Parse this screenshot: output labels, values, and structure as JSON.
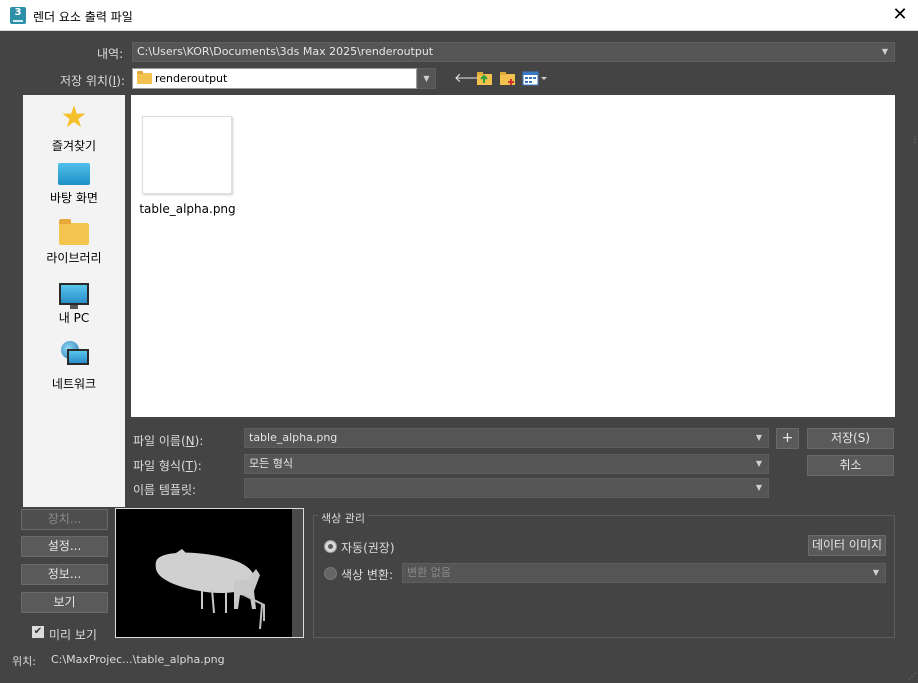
{
  "window": {
    "title": "렌더 요소 출력 파일",
    "app_badge": "3"
  },
  "history": {
    "label": "내역:",
    "value": "C:\\Users\\KOR\\Documents\\3ds Max 2025\\renderoutput"
  },
  "save_in": {
    "label_pre": "저장 위치(",
    "label_key": "I",
    "label_post": "):",
    "value": "renderoutput"
  },
  "toolbar": {
    "icons": [
      "back-arrow-icon",
      "up-folder-icon",
      "new-folder-icon",
      "view-menu-icon"
    ]
  },
  "places": [
    {
      "label": "즐겨찾기",
      "icon": "star-icon"
    },
    {
      "label": "바탕 화면",
      "icon": "desktop-icon"
    },
    {
      "label": "라이브러리",
      "icon": "library-folder-icon"
    },
    {
      "label": "내 PC",
      "icon": "pc-icon"
    },
    {
      "label": "네트워크",
      "icon": "network-icon"
    }
  ],
  "files": [
    {
      "name": "table_alpha.png"
    }
  ],
  "filename": {
    "label_pre": "파일 이름(",
    "label_key": "N",
    "label_post": "):",
    "value": "table_alpha.png"
  },
  "filetype": {
    "label_pre": "파일 형식(",
    "label_key": "T",
    "label_post": "):",
    "value": "모든 형식"
  },
  "name_template": {
    "label": "이름 템플릿:",
    "value": ""
  },
  "buttons": {
    "plus": "+",
    "save": "저장(S)",
    "cancel": "취소",
    "device": "장치...",
    "setup": "설정...",
    "info": "정보...",
    "view": "보기",
    "data_image": "데이터 이미지"
  },
  "preview_checkbox": {
    "label": "미리 보기",
    "checked": true
  },
  "color_management": {
    "title": "색상 관리",
    "auto_label": "자동(권장)",
    "transform_label": "색상 변환:",
    "transform_value": "변환 없음"
  },
  "status": {
    "label": "위치:",
    "value": "C:\\MaxProjec...\\table_alpha.png"
  },
  "colors": {
    "dialog_bg": "#444444",
    "list_bg": "#ffffff",
    "places_bg": "#f3f3f3"
  }
}
